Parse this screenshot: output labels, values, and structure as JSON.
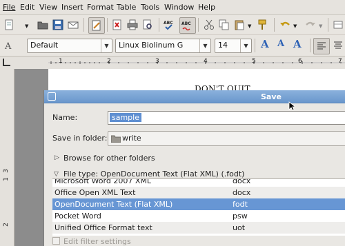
{
  "menu": [
    "File",
    "Edit",
    "View",
    "Insert",
    "Format",
    "Table",
    "Tools",
    "Window",
    "Help"
  ],
  "formatting": {
    "style": "Default",
    "font": "Liberation Sans",
    "font_display": "Linux Biolinum G",
    "size": "14"
  },
  "document": {
    "text": "DON'T QUIT"
  },
  "ruler": {
    "marks": [
      "1",
      "2",
      "3",
      "4",
      "5",
      "6",
      "7"
    ],
    "vmarks": [
      "1",
      "2",
      "3"
    ]
  },
  "dialog": {
    "title": "Save",
    "name_label": "Name:",
    "name_value": "sample",
    "folder_label": "Save in folder:",
    "folder_value": "write",
    "browse_label": "Browse for other folders",
    "filetype_label": "File type: OpenDocument Text (Flat XML) (.fodt)",
    "file_types": [
      {
        "name": "Microsoft Word 2007 XML",
        "ext": "docx"
      },
      {
        "name": "Office Open XML Text",
        "ext": "docx"
      },
      {
        "name": "OpenDocument Text (Flat XML)",
        "ext": "fodt"
      },
      {
        "name": "Pocket Word",
        "ext": "psw"
      },
      {
        "name": "Unified Office Format text",
        "ext": "uot"
      }
    ],
    "selected_index": 2,
    "edit_filter_label": "Edit filter settings"
  },
  "colors": {
    "selection": "#6796d4",
    "titlebar": "#6a97cc",
    "accent_font_icons": "#2e62b5"
  },
  "icons": [
    "new-document-icon",
    "open-folder-icon",
    "save-icon",
    "email-icon",
    "edit-mode-icon",
    "export-pdf-icon",
    "print-icon",
    "print-preview-icon",
    "spellcheck-icon",
    "autospellcheck-icon",
    "cut-icon",
    "copy-icon",
    "paste-icon",
    "clone-format-icon",
    "undo-icon",
    "redo-icon",
    "grow-font-icon",
    "shrink-font-icon",
    "font-color-icon",
    "align-left-icon",
    "align-center-icon"
  ]
}
